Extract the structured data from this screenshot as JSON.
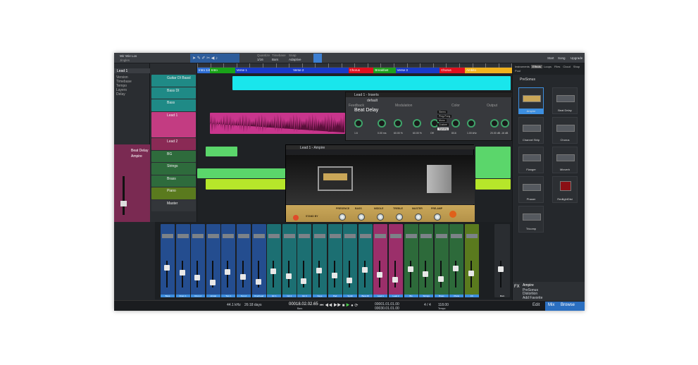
{
  "window": {
    "song_title": "Wir Wie Los",
    "song_sub": "Jingles"
  },
  "toolbar": {
    "quantize_label": "Quantize",
    "quantize_value": "1/16",
    "timebase_label": "Timebase",
    "timebase_value": "Bars",
    "snap_label": "Snap",
    "snap_value": "Adaptive",
    "start": "Start",
    "song_menu": "Song",
    "upgrade": "Upgrade"
  },
  "markers": [
    {
      "label": "Intro 1/4",
      "color": "#2f6fd6",
      "start": 0,
      "end": 4
    },
    {
      "label": "Intro",
      "color": "#19a319",
      "start": 4,
      "end": 12
    },
    {
      "label": "Verse 1",
      "color": "#1a3bc7",
      "start": 12,
      "end": 30
    },
    {
      "label": "Verse 2",
      "color": "#1a3bc7",
      "start": 30,
      "end": 48
    },
    {
      "label": "Chorus",
      "color": "#e0101e",
      "start": 48,
      "end": 56
    },
    {
      "label": "Breakfast",
      "color": "#1ea01e",
      "start": 56,
      "end": 63
    },
    {
      "label": "Verse 3",
      "color": "#1a3bc7",
      "start": 63,
      "end": 77
    },
    {
      "label": "Chorus",
      "color": "#e0101e",
      "start": 77,
      "end": 85
    },
    {
      "label": "Ambito",
      "color": "#f0b21e",
      "start": 85,
      "end": 100
    }
  ],
  "inspector": {
    "track_name": "Lead 1",
    "fields": [
      "Version",
      "Timebase",
      "Tempo",
      "Layers",
      "Delay"
    ],
    "instrument": "Ampire",
    "chain": [
      "Beat Delay",
      "Ampire"
    ]
  },
  "tracks": [
    {
      "name": "Guitar DI Bassl",
      "color": "#1f8a86"
    },
    {
      "name": "Bass DI",
      "color": "#1f8a86"
    },
    {
      "name": "Bass",
      "color": "#1f8a86"
    },
    {
      "name": "Lead 1",
      "color": "#c33c82"
    },
    {
      "name": "Lead 2",
      "color": "#8a2a55"
    },
    {
      "name": "BG",
      "color": "#2e6b3c"
    },
    {
      "name": "Strings",
      "color": "#2e6b3c"
    },
    {
      "name": "Brass",
      "color": "#2e6b3c"
    },
    {
      "name": "Piano",
      "color": "#5a7a1e"
    },
    {
      "name": "Master",
      "color": "#33363a"
    }
  ],
  "beat_delay": {
    "title": "Beat Delay",
    "tab": "Lead 1 - Inserts",
    "preset": "default",
    "sections": [
      "Feedback",
      "Modulation",
      "Color",
      "Output"
    ],
    "values": [
      "1.6",
      "0.00 ms",
      "60.00 %",
      "60.00 %",
      "Off",
      "8/16",
      "1.00 kHz",
      "20.00 dB",
      "-16 dB"
    ],
    "modes": [
      "Stereo",
      "Ping-Pong",
      "Mono",
      "Custom",
      "Syncing"
    ]
  },
  "ampire": {
    "title": "Lead 1 - Ampire",
    "controls": [
      "PRESENCE",
      "BASS",
      "MIDDLE",
      "TREBLE",
      "MASTER",
      "PRE-AMP"
    ],
    "volume_label": "VOLUME",
    "switch_label": "STAND BY"
  },
  "browser": {
    "tabs": [
      "Instruments",
      "Effects",
      "Loops",
      "Files",
      "Cloud",
      "Shop",
      "Pool"
    ],
    "active_tab": "Effects",
    "folder": "PreSonus",
    "items": [
      "Ampire",
      "Beat Delay",
      "Channel Strip",
      "Chorus",
      "Flanger",
      "Mixverb",
      "Phaser",
      "RedlightDist",
      "Tricomp"
    ],
    "selected": "Ampire",
    "info_title": "Ampire",
    "info_vendor": "PreSonus",
    "info_category": "Distortion",
    "footer": "Add Favorite"
  },
  "mixer": {
    "channels": [
      {
        "name": "Bass",
        "color": "#244d8f"
      },
      {
        "name": "Drum 1",
        "color": "#244d8f"
      },
      {
        "name": "Drum 2",
        "color": "#244d8f"
      },
      {
        "name": "Hi Hat",
        "color": "#244d8f"
      },
      {
        "name": "Tom 1",
        "color": "#244d8f"
      },
      {
        "name": "Tom 2",
        "color": "#244d8f"
      },
      {
        "name": "Overhead",
        "color": "#244d8f"
      },
      {
        "name": "Gtr 1",
        "color": "#1c6f72"
      },
      {
        "name": "Gtr 2",
        "color": "#1c6f72"
      },
      {
        "name": "Gtr 3",
        "color": "#1c6f72"
      },
      {
        "name": "Keys",
        "color": "#1c6f72"
      },
      {
        "name": "Pad",
        "color": "#1c6f72"
      },
      {
        "name": "Synth",
        "color": "#1c6f72"
      },
      {
        "name": "Bass DI",
        "color": "#1c6f72"
      },
      {
        "name": "Lead 1",
        "color": "#9b2f6a"
      },
      {
        "name": "Lead 2",
        "color": "#9b2f6a"
      },
      {
        "name": "BG",
        "color": "#2d6a3a"
      },
      {
        "name": "Strings",
        "color": "#2d6a3a"
      },
      {
        "name": "Brass",
        "color": "#2d6a3a"
      },
      {
        "name": "Piano",
        "color": "#2d6a3a"
      },
      {
        "name": "FX",
        "color": "#5a7a1e"
      }
    ],
    "master": "Main"
  },
  "transport": {
    "sample_rate": "44.1 kHz",
    "record_max": "26:18 days",
    "position": "00018.02.02.65",
    "position_label": "Bars",
    "left": "00001.01.01.00",
    "right": "00030.01.01.00",
    "signature": "4 / 4",
    "tempo": "118.00",
    "tempo_label": "Tempo"
  },
  "footer_buttons": [
    "Edit",
    "Mix",
    "Browse"
  ]
}
